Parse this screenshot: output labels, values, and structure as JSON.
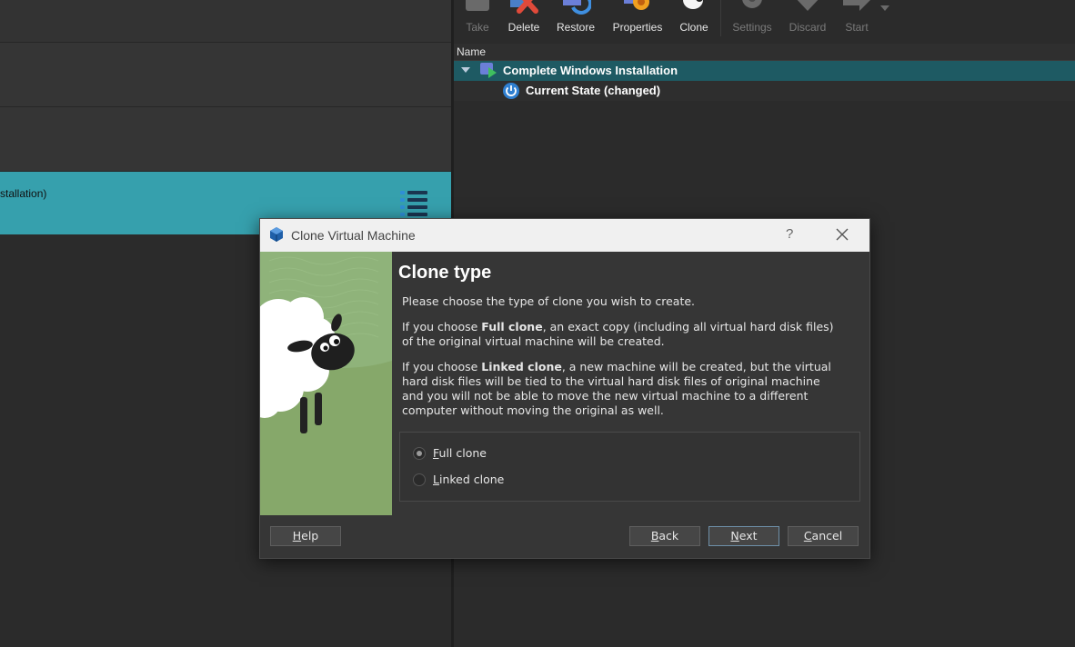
{
  "left_pane": {
    "selected_vm_fragment": "stallation)"
  },
  "toolbar": {
    "buttons": [
      {
        "label": "Take",
        "icon": "take-snapshot-icon",
        "enabled": false
      },
      {
        "label": "Delete",
        "icon": "delete-snapshot-icon",
        "enabled": true
      },
      {
        "label": "Restore",
        "icon": "restore-snapshot-icon",
        "enabled": true
      },
      {
        "label": "Properties",
        "icon": "properties-icon",
        "enabled": true
      },
      {
        "label": "Clone",
        "icon": "clone-icon",
        "enabled": true
      },
      {
        "label": "Settings",
        "icon": "settings-icon",
        "enabled": false
      },
      {
        "label": "Discard",
        "icon": "discard-icon",
        "enabled": false
      },
      {
        "label": "Start",
        "icon": "start-icon",
        "enabled": false
      }
    ]
  },
  "snapshot_tree": {
    "column_header": "Name",
    "rows": [
      {
        "label": "Complete Windows Installation",
        "icon": "snapshot-icon"
      },
      {
        "label": "Current State (changed)",
        "icon": "power-icon"
      }
    ]
  },
  "dialog": {
    "title": "Clone Virtual Machine",
    "help_glyph": "?",
    "heading": "Clone type",
    "intro": "Please choose the type of clone you wish to create.",
    "full_clone_para": {
      "before": "If you choose ",
      "bold": "Full clone",
      "after": ", an exact copy (including all virtual hard disk files) of the original virtual machine will be created."
    },
    "linked_clone_para": {
      "before": "If you choose ",
      "bold": "Linked clone",
      "after": ", a new machine will be created, but the virtual hard disk files will be tied to the virtual hard disk files of original machine and you will not be able to move the new virtual machine to a different computer without moving the original as well."
    },
    "options": [
      {
        "mnemonic": "F",
        "rest": "ull clone",
        "checked": true
      },
      {
        "mnemonic": "L",
        "rest": "inked clone",
        "checked": false
      }
    ],
    "buttons": {
      "help": {
        "mnemonic": "H",
        "rest": "elp"
      },
      "back": {
        "mnemonic": "B",
        "rest": "ack"
      },
      "next": {
        "mnemonic": "N",
        "rest": "ext"
      },
      "cancel": {
        "mnemonic": "C",
        "rest": "ancel"
      }
    }
  },
  "colors": {
    "selected_row": "#36a0ad",
    "tree_selected": "#1e5a63",
    "art_green": "#7a9e5e"
  }
}
